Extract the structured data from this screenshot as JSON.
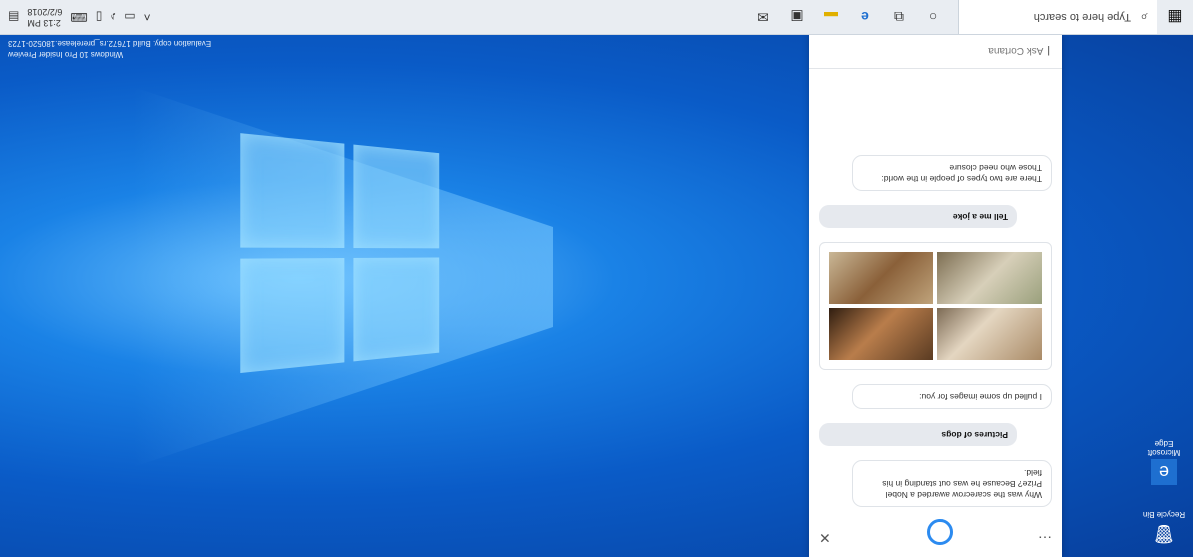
{
  "taskbar": {
    "search_placeholder": "Type here to search",
    "clock_time": "2:13 PM",
    "clock_date": "6/2/2018",
    "tray_icons": [
      "chevron-up-icon",
      "network-icon",
      "volume-icon",
      "battery-icon",
      "keyboard-icon"
    ],
    "pinned_icons": [
      "task-view-icon",
      "edge-icon",
      "file-explorer-icon",
      "store-icon",
      "mail-icon"
    ]
  },
  "desktop": {
    "recycle_bin_label": "Recycle Bin",
    "edge_label": "Microsoft Edge",
    "watermark_line1": "Windows 10 Pro Insider Preview",
    "watermark_line2": "Evaluation copy. Build 17672.rs_prerelease.180520-1723"
  },
  "cortana": {
    "messages": [
      {
        "role": "bot",
        "text": "Why was the scarecrow awarded a Nobel Prize? Because he was out standing in his field."
      },
      {
        "role": "user",
        "text": "Pictures of dogs"
      },
      {
        "role": "bot",
        "text": "I pulled up some images for you:"
      },
      {
        "role": "user",
        "text": "Tell me a joke"
      },
      {
        "role": "bot",
        "text": "There are two types of people in the world: Those who need closure"
      }
    ],
    "ask_placeholder": "Ask Cortana"
  }
}
